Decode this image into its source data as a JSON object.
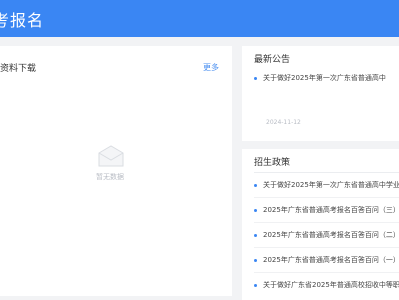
{
  "header": {
    "title": "考报名"
  },
  "downloads": {
    "title": "资料下载",
    "more_label": "更多",
    "empty_text": "暂无数据"
  },
  "notices": {
    "title": "最新公告",
    "items": [
      {
        "text": "关于做好2025年第一次广东省普通高中",
        "date": "2024-11-12"
      }
    ]
  },
  "policies": {
    "title": "招生政策",
    "items": [
      {
        "text": "关于做好2025年第一次广东省普通高中学业"
      },
      {
        "text": "2025年广东省普通高考报名百答百问（三）"
      },
      {
        "text": "2025年广东省普通高考报名百答百问（二）"
      },
      {
        "text": "2025年广东省普通高考报名百答百问（一）"
      },
      {
        "text": "关于做好广东省2025年普通高校招收中等职"
      }
    ]
  },
  "colors": {
    "brand": "#3a86f3",
    "link": "#4a8ff0"
  }
}
